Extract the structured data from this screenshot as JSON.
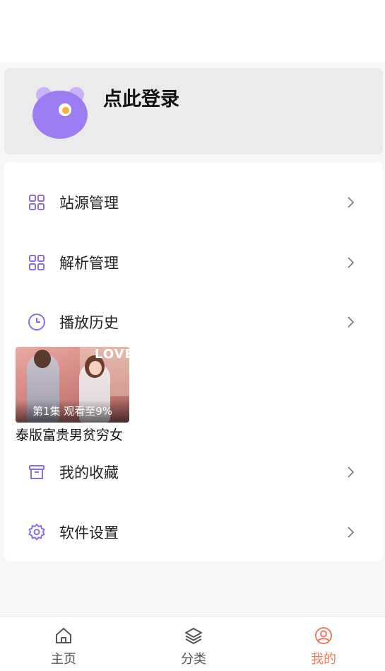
{
  "profile": {
    "login_label": "点此登录"
  },
  "menu": {
    "items": [
      {
        "label": "站源管理",
        "icon": "grid-icon"
      },
      {
        "label": "解析管理",
        "icon": "grid-icon"
      },
      {
        "label": "播放历史",
        "icon": "clock-icon"
      },
      {
        "label": "我的收藏",
        "icon": "archive-box-icon"
      },
      {
        "label": "软件设置",
        "icon": "gear-icon"
      }
    ]
  },
  "history": {
    "items": [
      {
        "title": "泰版富贵男贫穷女",
        "progress": "第1集  观看至9%",
        "poster_text": "LOVE"
      }
    ]
  },
  "tabbar": {
    "tabs": [
      {
        "label": "主页",
        "icon": "home-icon",
        "active": false
      },
      {
        "label": "分类",
        "icon": "layers-icon",
        "active": false
      },
      {
        "label": "我的",
        "icon": "user-icon",
        "active": true
      }
    ]
  },
  "colors": {
    "accent": "#8b6cf0",
    "tab_active": "#ef7a5f",
    "avatar": "#9d7cf2"
  }
}
